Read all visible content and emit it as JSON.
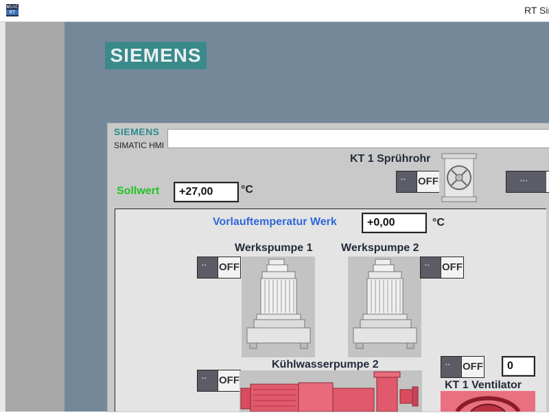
{
  "window": {
    "icon_line1": "WinC",
    "icon_line2": "RT",
    "title": "RT Sim"
  },
  "brand": {
    "logo": "SIEMENS",
    "header_logo": "SIEMENS",
    "header_subtitle": "SIMATIC HMI"
  },
  "labels": {
    "spruehrohr": "KT 1 Sprührohr",
    "sollwert": "Sollwert",
    "vorlauf": "Vorlauftemperatur Werk",
    "werkspumpe1": "Werkspumpe 1",
    "werkspumpe2": "Werkspumpe 2",
    "kuehlwasserpumpe2": "Kühlwasserpumpe 2",
    "ventilator": "KT 1 Ventilator"
  },
  "values": {
    "sollwert": "+27,00",
    "vorlauf": "+0,00",
    "ventilator_count": "0"
  },
  "units": {
    "sollwert": "°C",
    "vorlauf": "°C"
  },
  "toggles": {
    "spruehrohr": "OFF",
    "werkspumpe1": "OFF",
    "werkspumpe2": "OFF",
    "kuehlwasserpumpe2": "OFF",
    "ventilator": "OFF"
  },
  "colors": {
    "background": "#75889a",
    "siemens_teal": "#3a8a8c",
    "sollwert_label": "#22c322",
    "vorlauf_label": "#2f67d8",
    "pump_red": "#e05a6b"
  },
  "icons": {
    "valve": "valve-icon",
    "pump": "submersible-pump-icon",
    "motor": "motor-pump-icon",
    "fan": "fan-icon"
  }
}
